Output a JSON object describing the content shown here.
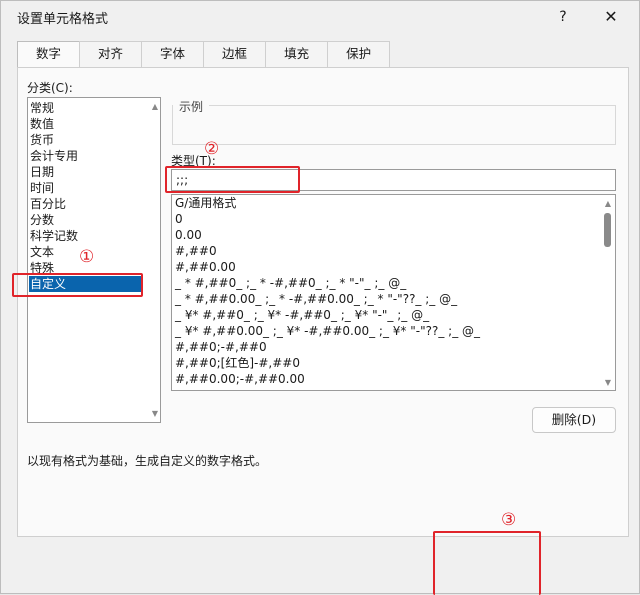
{
  "dialog": {
    "title": "设置单元格格式",
    "help_icon": "?",
    "close_icon": "✕"
  },
  "tabs": [
    {
      "label": "数字",
      "active": true
    },
    {
      "label": "对齐",
      "active": false
    },
    {
      "label": "字体",
      "active": false
    },
    {
      "label": "边框",
      "active": false
    },
    {
      "label": "填充",
      "active": false
    },
    {
      "label": "保护",
      "active": false
    }
  ],
  "category": {
    "label": "分类(C):",
    "items": [
      "常规",
      "数值",
      "货币",
      "会计专用",
      "日期",
      "时间",
      "百分比",
      "分数",
      "科学记数",
      "文本",
      "特殊",
      "自定义"
    ],
    "selected": "自定义"
  },
  "sample": {
    "label": "示例"
  },
  "type": {
    "label": "类型(T):",
    "value": ";;;"
  },
  "formats": [
    "G/通用格式",
    "0",
    "0.00",
    "#,##0",
    "#,##0.00",
    "_ * #,##0_ ;_ * -#,##0_ ;_ * \"-\"_ ;_ @_",
    "_ * #,##0.00_ ;_ * -#,##0.00_ ;_ * \"-\"??_ ;_ @_",
    "_ ¥* #,##0_ ;_ ¥* -#,##0_ ;_ ¥* \"-\"_ ;_ @_",
    "_ ¥* #,##0.00_ ;_ ¥* -#,##0.00_ ;_ ¥* \"-\"??_ ;_ @_",
    "#,##0;-#,##0",
    "#,##0;[红色]-#,##0",
    "#,##0.00;-#,##0.00"
  ],
  "delete_button": "删除(D)",
  "description": "以现有格式为基础，生成自定义的数字格式。",
  "annotations": {
    "one": "①",
    "two": "②",
    "three": "③",
    "color": "#e0242a"
  },
  "colors": {
    "selection": "#0a64ad"
  }
}
